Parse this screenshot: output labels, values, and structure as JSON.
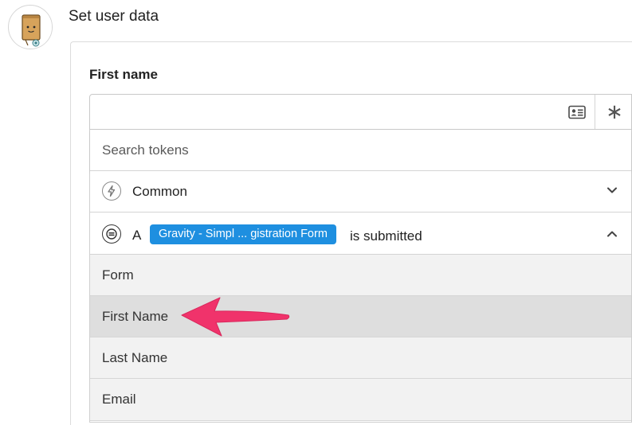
{
  "step": {
    "title": "Set user data"
  },
  "field": {
    "label": "First name",
    "value": ""
  },
  "token_icon": "id-card-icon",
  "asterisk_icon": "asterisk-icon",
  "asterisk_glyph": "∗",
  "search": {
    "placeholder": "Search tokens"
  },
  "groups": {
    "common": {
      "label": "Common",
      "icon": "lightning-icon",
      "expanded": false
    },
    "trigger": {
      "prefix": "A",
      "pill": "Gravity - Simpl ... gistration Form",
      "suffix": "is submitted",
      "icon": "gravity-forms-icon",
      "expanded": true
    }
  },
  "items": [
    {
      "label": "Form"
    },
    {
      "label": "First Name",
      "highlighted": true
    },
    {
      "label": "Last Name"
    },
    {
      "label": "Email"
    }
  ],
  "colors": {
    "pill_bg": "#1e8fe0",
    "arrow": "#f0336b",
    "item_bg": "#f2f2f2",
    "item_active_bg": "#dedede"
  }
}
